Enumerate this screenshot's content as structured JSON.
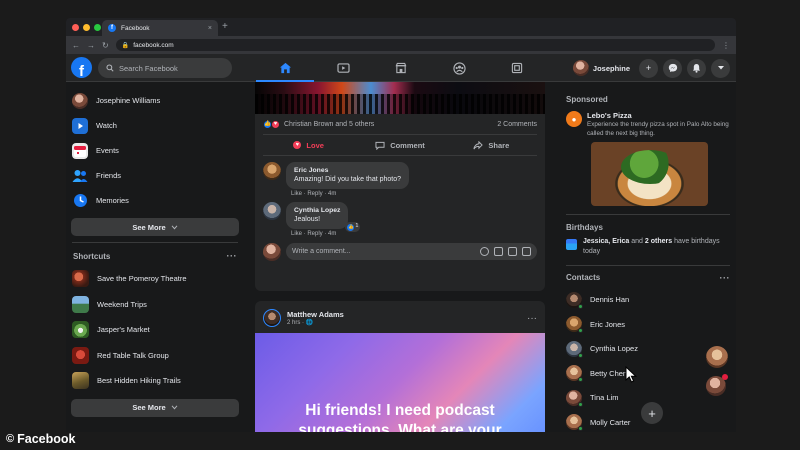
{
  "browser": {
    "tab_title": "Facebook",
    "tab_close": "×",
    "new_tab": "+",
    "url": "facebook.com",
    "traffic_colors": [
      "#ff5f57",
      "#febc2e",
      "#28c840"
    ]
  },
  "nav": {
    "logo_letter": "f",
    "search_placeholder": "Search Facebook",
    "profile_name": "Josephine",
    "icons": [
      "home-icon",
      "watch-icon",
      "marketplace-icon",
      "groups-icon",
      "gaming-icon"
    ],
    "accent": "#2d88ff"
  },
  "left": {
    "items": [
      {
        "label": "Josephine Williams",
        "icon": "avatar"
      },
      {
        "label": "Watch",
        "icon": "watch-icon"
      },
      {
        "label": "Events",
        "icon": "events-icon"
      },
      {
        "label": "Friends",
        "icon": "friends-icon"
      },
      {
        "label": "Memories",
        "icon": "memories-icon"
      }
    ],
    "see_more": "See More",
    "shortcuts_title": "Shortcuts",
    "shortcuts": [
      {
        "label": "Save the Pomeroy Theatre"
      },
      {
        "label": "Weekend Trips"
      },
      {
        "label": "Jasper's Market"
      },
      {
        "label": "Red Table Talk Group"
      },
      {
        "label": "Best Hidden Hiking Trails"
      }
    ],
    "see_more_2": "See More"
  },
  "post1": {
    "reactions_text": "Christian Brown and 5 others",
    "comments_count": "2 Comments",
    "actions": {
      "love": "Love",
      "comment": "Comment",
      "share": "Share"
    },
    "comments": [
      {
        "name": "Eric Jones",
        "text": "Amazing! Did you take that photo?",
        "meta": "Like · Reply · 4m"
      },
      {
        "name": "Cynthia Lopez",
        "text": "Jealous!",
        "meta": "Like · Reply · 4m",
        "like_count": "1"
      }
    ],
    "write_placeholder": "Write a comment..."
  },
  "post2": {
    "author": "Matthew Adams",
    "time": "2 hrs · ",
    "menu": "···",
    "text": "Hi friends! I need podcast suggestions. What are your favorite?"
  },
  "right": {
    "sponsored_title": "Sponsored",
    "sponsor_name": "Lebo's Pizza",
    "sponsor_desc": "Experience the trendy pizza spot in Palo Alto being called the next big thing.",
    "birthdays_title": "Birthdays",
    "bday_names": "Jessica, Erica",
    "bday_mid": " and ",
    "bday_others": "2 others",
    "bday_tail": " have birthdays today",
    "contacts_title": "Contacts",
    "contacts": [
      {
        "name": "Dennis Han"
      },
      {
        "name": "Eric Jones"
      },
      {
        "name": "Cynthia Lopez"
      },
      {
        "name": "Betty Chen"
      },
      {
        "name": "Tina Lim"
      },
      {
        "name": "Molly Carter"
      }
    ],
    "menu": "···"
  },
  "watermark": {
    "symbol": "©",
    "text": "Facebook"
  }
}
